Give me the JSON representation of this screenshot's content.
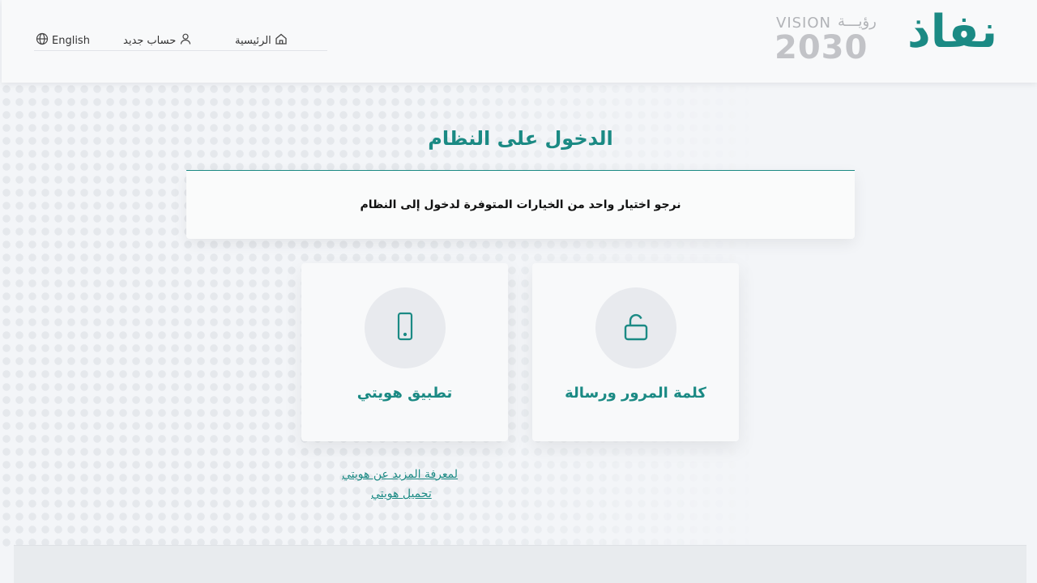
{
  "header": {
    "nav": {
      "language_label": "English",
      "new_account_label": "حساب جديد",
      "home_label": "الرئيسية"
    },
    "logos": {
      "vision_word": "VISION",
      "vision_arabic": "رؤيـــة",
      "vision_year": "2030",
      "brand_name": "نفاذ"
    }
  },
  "main": {
    "title": "الدخول على النظام",
    "instruction": "نرجو اختيار واحد من الخيارات المتوفرة لدخول إلى النظام",
    "options": [
      {
        "label": "تطبيق هويتي",
        "icon": "mobile-phone-icon"
      },
      {
        "label": "كلمة المرور ورسالة",
        "icon": "unlock-icon"
      }
    ],
    "links": {
      "learn_more": "لمعرفة المزيد عن هويتي",
      "download": "تحميل هويتي"
    }
  },
  "colors": {
    "brand": "#1b8a84",
    "background": "#f3f5f8",
    "card": "#f8f9fa",
    "icon_circle": "#e8eaee"
  }
}
